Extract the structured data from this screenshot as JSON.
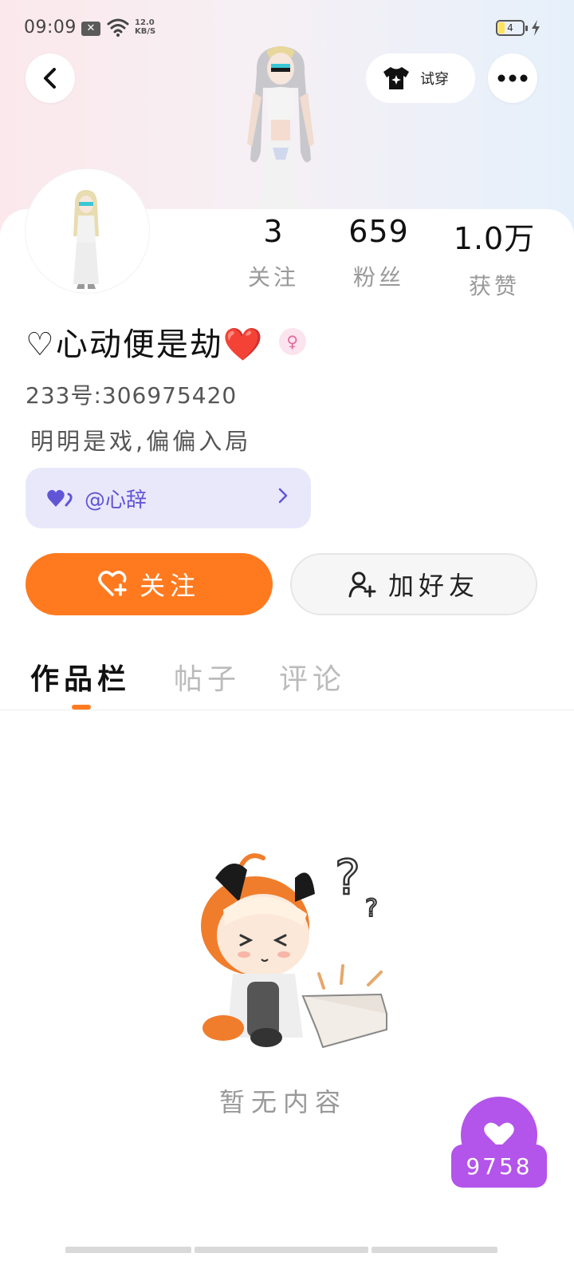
{
  "status_bar": {
    "time": "09:09",
    "network_speed_value": "12.0",
    "network_speed_unit": "KB/S",
    "battery_level": "4"
  },
  "header": {
    "tryon_label": "试穿"
  },
  "stats": [
    {
      "value": "3",
      "label": "关注"
    },
    {
      "value": "659",
      "label": "粉丝"
    },
    {
      "value": "1.0万",
      "label": "获赞"
    }
  ],
  "profile": {
    "nickname": "♡心动便是劫❤️",
    "gender_symbol": "♀",
    "uid": "233号:306975420",
    "bio": "明明是戏,偏偏入局",
    "cp_tag": "@心辞"
  },
  "actions": {
    "follow_label": "关注",
    "add_friend_label": "加好友"
  },
  "tabs": [
    {
      "label": "作品栏",
      "active": true
    },
    {
      "label": "帖子",
      "active": false
    },
    {
      "label": "评论",
      "active": false
    }
  ],
  "empty_state": {
    "text": "暂无内容"
  },
  "floating_like": {
    "count": "9758"
  },
  "colors": {
    "accent": "#ff7a1f",
    "cp_tag_bg": "#e9e8fb",
    "cp_tag_text": "#6155d6",
    "like_purple": "#b354ea"
  }
}
